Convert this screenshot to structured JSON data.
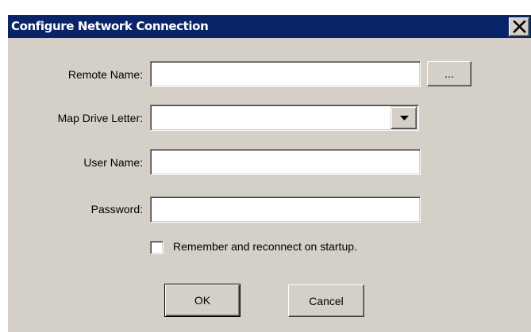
{
  "window": {
    "title": "Configure Network Connection",
    "close_symbol": "✕"
  },
  "form": {
    "remote_name": {
      "label": "Remote Name:",
      "value": "",
      "browse_label": "..."
    },
    "drive_letter": {
      "label": "Map Drive Letter:",
      "value": ""
    },
    "user_name": {
      "label": "User Name:",
      "value": ""
    },
    "password": {
      "label": "Password:",
      "value": ""
    },
    "reconnect": {
      "label": "Remember and reconnect on startup.",
      "checked": false
    }
  },
  "actions": {
    "ok_label": "OK",
    "cancel_label": "Cancel"
  },
  "colors": {
    "titlebar": "#0a246a",
    "face": "#d4d0c8",
    "title_text": "#ffffff"
  },
  "icons": {
    "close": "close-icon",
    "dropdown": "chevron-down-icon"
  }
}
